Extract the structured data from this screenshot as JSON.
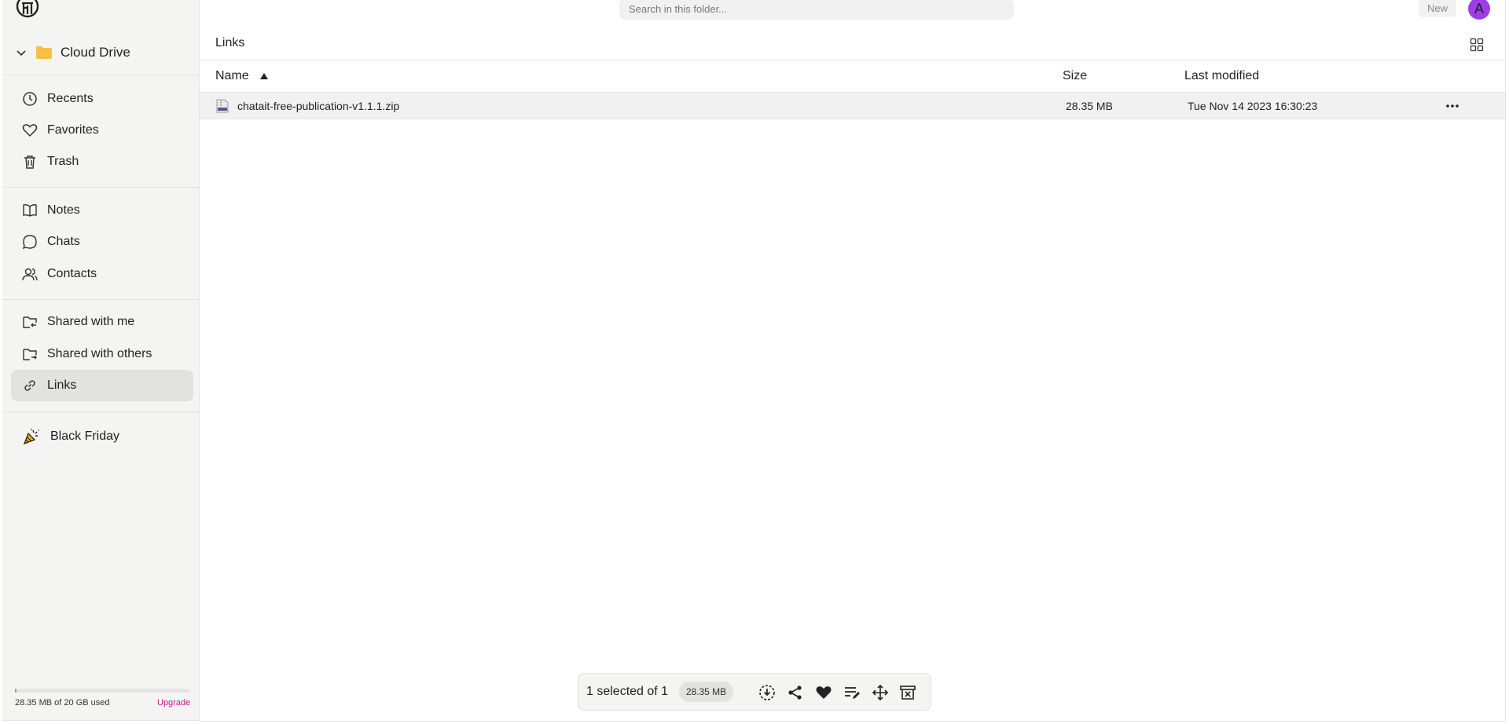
{
  "sidebar": {
    "drive": {
      "label": "Cloud Drive"
    },
    "items": [
      {
        "label": "Recents",
        "icon": "clock-icon"
      },
      {
        "label": "Favorites",
        "icon": "heart-icon"
      },
      {
        "label": "Trash",
        "icon": "trash-icon"
      },
      {
        "label": "Notes",
        "icon": "book-icon"
      },
      {
        "label": "Chats",
        "icon": "chat-bubble-icon"
      },
      {
        "label": "Contacts",
        "icon": "users-icon"
      },
      {
        "label": "Shared with me",
        "icon": "folder-shared-in-icon"
      },
      {
        "label": "Shared with others",
        "icon": "folder-shared-out-icon"
      },
      {
        "label": "Links",
        "icon": "link-icon",
        "active": true
      },
      {
        "label": "Black Friday",
        "icon": "party-popper-icon"
      }
    ],
    "storage": {
      "text": "28.35 MB of 20 GB used",
      "fraction": 0.0014,
      "upgrade_label": "Upgrade"
    }
  },
  "topbar": {
    "search_placeholder": "Search in this folder...",
    "new_label": "New",
    "avatar_letter": "A"
  },
  "main": {
    "title": "Links",
    "columns": {
      "name": "Name",
      "size": "Size",
      "modified": "Last modified"
    },
    "files": [
      {
        "name": "chatait-free-publication-v1.1.1.zip",
        "size": "28.35 MB",
        "modified": "Tue Nov 14 2023 16:30:23"
      }
    ]
  },
  "selection": {
    "text": "1 selected of 1",
    "size": "28.35 MB"
  },
  "colors": {
    "accent_upgrade": "#c41a8b",
    "avatar": "#9b3de8",
    "folder": "#f7c044"
  }
}
